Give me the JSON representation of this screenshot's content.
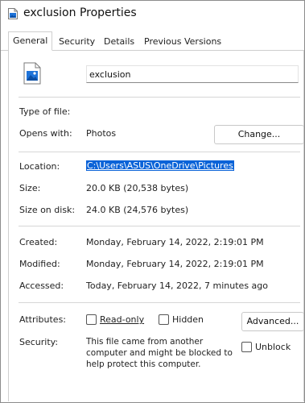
{
  "window": {
    "title": "exclusion Properties"
  },
  "tabs": [
    {
      "label": "General",
      "active": true
    },
    {
      "label": "Security",
      "active": false
    },
    {
      "label": "Details",
      "active": false
    },
    {
      "label": "Previous Versions",
      "active": false
    }
  ],
  "general": {
    "file_name": "exclusion",
    "type_of_file_label": "Type of file:",
    "type_of_file_value": "",
    "opens_with_label": "Opens with:",
    "opens_with_value": "Photos",
    "change_button": "Change...",
    "location_label": "Location:",
    "location_value": "C:\\Users\\ASUS\\OneDrive\\Pictures",
    "size_label": "Size:",
    "size_value": "20.0 KB (20,538 bytes)",
    "size_on_disk_label": "Size on disk:",
    "size_on_disk_value": "24.0 KB (24,576 bytes)",
    "created_label": "Created:",
    "created_value": "Monday, February 14, 2022, 2:19:01 PM",
    "modified_label": "Modified:",
    "modified_value": "Monday, February 14, 2022, 2:19:01 PM",
    "accessed_label": "Accessed:",
    "accessed_value": "Today, February 14, 2022, 7 minutes ago",
    "attributes_label": "Attributes:",
    "read_only_label": "Read-only",
    "read_only_checked": false,
    "hidden_label": "Hidden",
    "hidden_checked": false,
    "advanced_button": "Advanced...",
    "security_label": "Security:",
    "security_text": "This file came from another computer and might be blocked to help protect this computer.",
    "unblock_label": "Unblock",
    "unblock_checked": false
  },
  "icons": {
    "title_icon": "image-file-icon",
    "file_icon": "image-file-icon"
  },
  "colors": {
    "selection": "#0a63d8",
    "icon_accent": "#1e73d9"
  }
}
